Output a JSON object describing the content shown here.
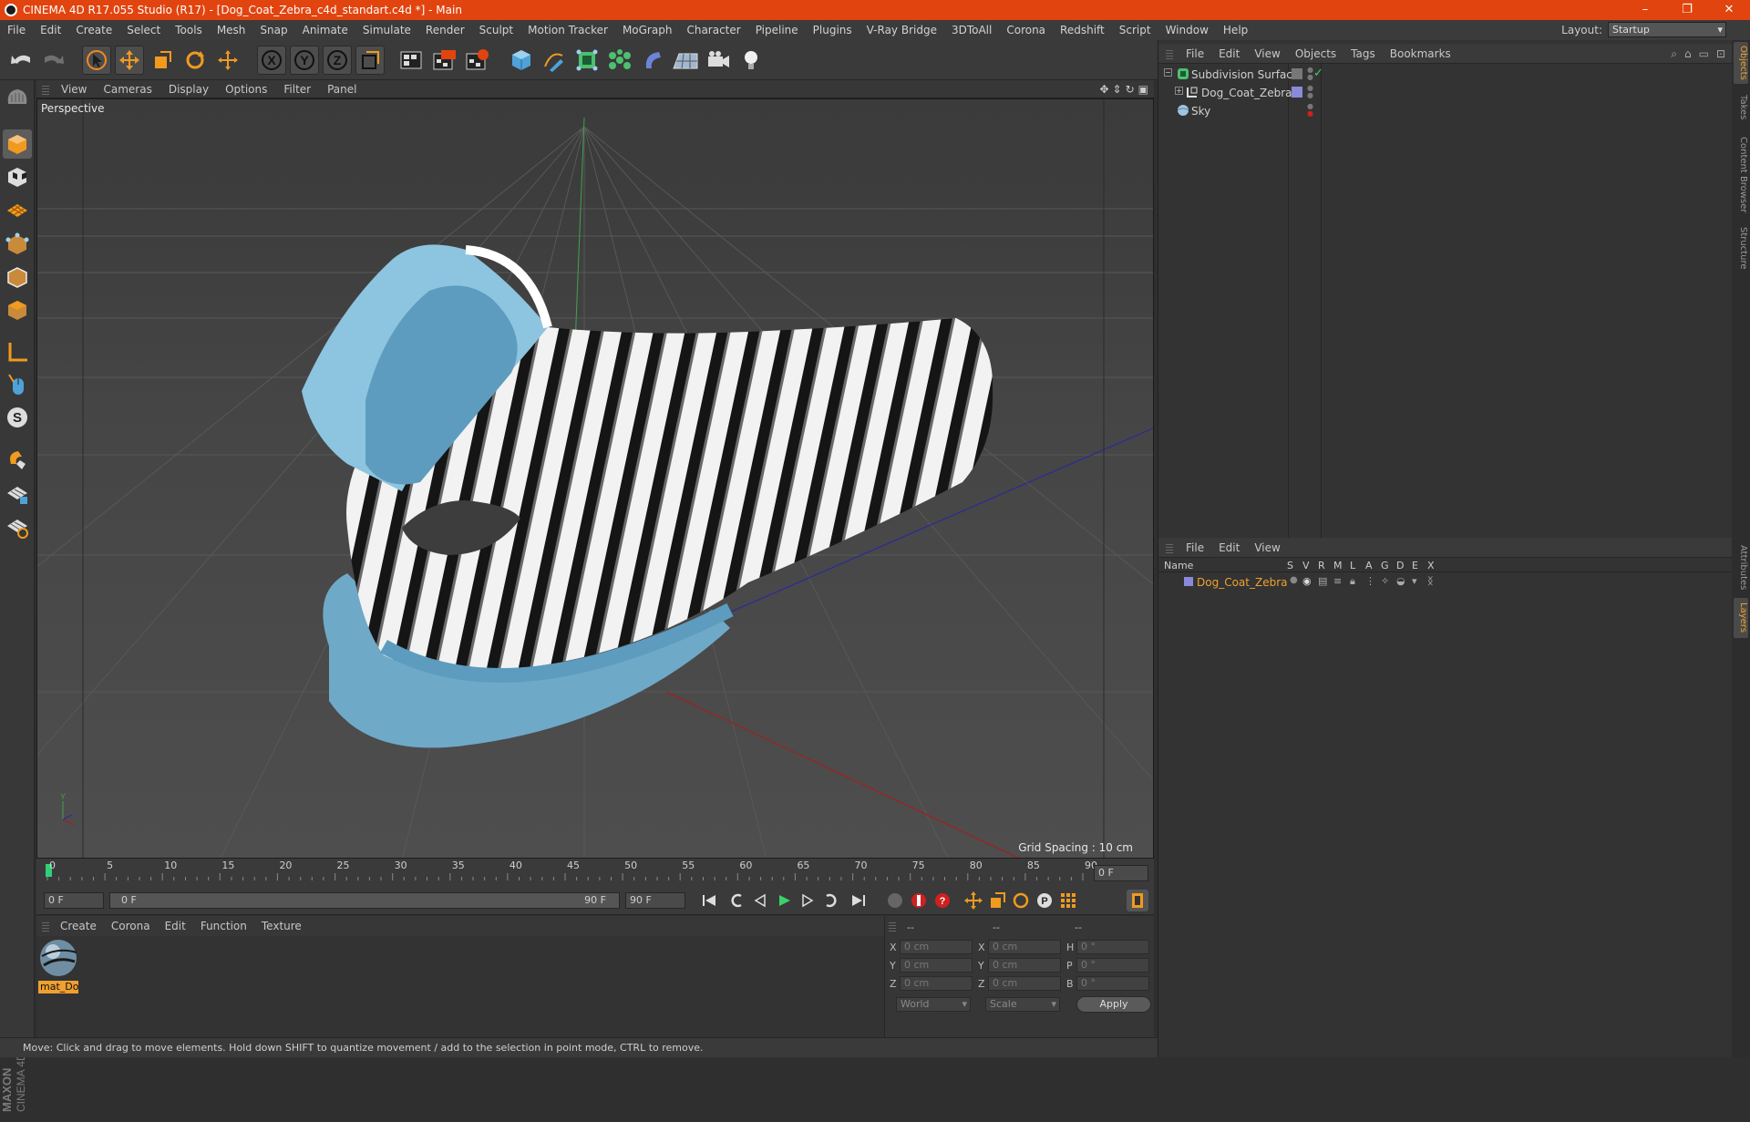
{
  "window": {
    "title": "CINEMA 4D R17.055 Studio (R17) - [Dog_Coat_Zebra_c4d_standart.c4d *] - Main",
    "controls": [
      "–",
      "❐",
      "✕"
    ]
  },
  "menubar": {
    "items": [
      "File",
      "Edit",
      "Create",
      "Select",
      "Tools",
      "Mesh",
      "Snap",
      "Animate",
      "Simulate",
      "Render",
      "Sculpt",
      "Motion Tracker",
      "MoGraph",
      "Character",
      "Pipeline",
      "Plugins",
      "V-Ray Bridge",
      "3DToAll",
      "Corona",
      "Redshift",
      "Script",
      "Window",
      "Help"
    ],
    "layout_label": "Layout:",
    "layout_value": "Startup"
  },
  "viewport": {
    "menu": [
      "View",
      "Cameras",
      "Display",
      "Options",
      "Filter",
      "Panel"
    ],
    "label": "Perspective",
    "grid_spacing": "Grid Spacing : 10 cm"
  },
  "timeline": {
    "ticks": [
      "0",
      "5",
      "10",
      "15",
      "20",
      "25",
      "30",
      "35",
      "40",
      "45",
      "50",
      "55",
      "60",
      "65",
      "70",
      "75",
      "80",
      "85",
      "90"
    ],
    "current_frame_display": "0 F",
    "start_field": "0 F",
    "range_start": "0 F",
    "range_end": "90 F",
    "end_field": "90 F"
  },
  "material_manager": {
    "menu": [
      "Create",
      "Corona",
      "Edit",
      "Function",
      "Texture"
    ],
    "materials": [
      {
        "name": "mat_Do"
      }
    ]
  },
  "coordinates": {
    "headers": [
      "--",
      "--",
      "--"
    ],
    "rows": [
      {
        "a": "X",
        "pos": "0 cm",
        "b": "X",
        "size": "0 cm",
        "c": "H",
        "rot": "0 °"
      },
      {
        "a": "Y",
        "pos": "0 cm",
        "b": "Y",
        "size": "0 cm",
        "c": "P",
        "rot": "0 °"
      },
      {
        "a": "Z",
        "pos": "0 cm",
        "b": "Z",
        "size": "0 cm",
        "c": "B",
        "rot": "0 °"
      }
    ],
    "mode_world": "World",
    "mode_scale": "Scale",
    "apply": "Apply"
  },
  "status": "Move: Click and drag to move elements. Hold down SHIFT to quantize movement / add to the selection in point mode, CTRL to remove.",
  "object_manager": {
    "menu": [
      "File",
      "Edit",
      "View",
      "Objects",
      "Tags",
      "Bookmarks"
    ],
    "objects": [
      {
        "name": "Subdivision Surface"
      },
      {
        "name": "Dog_Coat_Zebra"
      },
      {
        "name": "Sky"
      }
    ]
  },
  "layer_manager": {
    "menu": [
      "File",
      "Edit",
      "View"
    ],
    "columns": [
      "Name",
      "S",
      "V",
      "R",
      "M",
      "L",
      "A",
      "G",
      "D",
      "E",
      "X"
    ],
    "layers": [
      {
        "name": "Dog_Coat_Zebra"
      }
    ]
  },
  "side_tabs": [
    "Objects",
    "Takes",
    "Content Browser",
    "Structure",
    "Attributes",
    "Layers"
  ],
  "colors": {
    "titlebar": "#e2440f",
    "accent_orange": "#f0a030",
    "coat_blue": "#7eb8d6"
  }
}
